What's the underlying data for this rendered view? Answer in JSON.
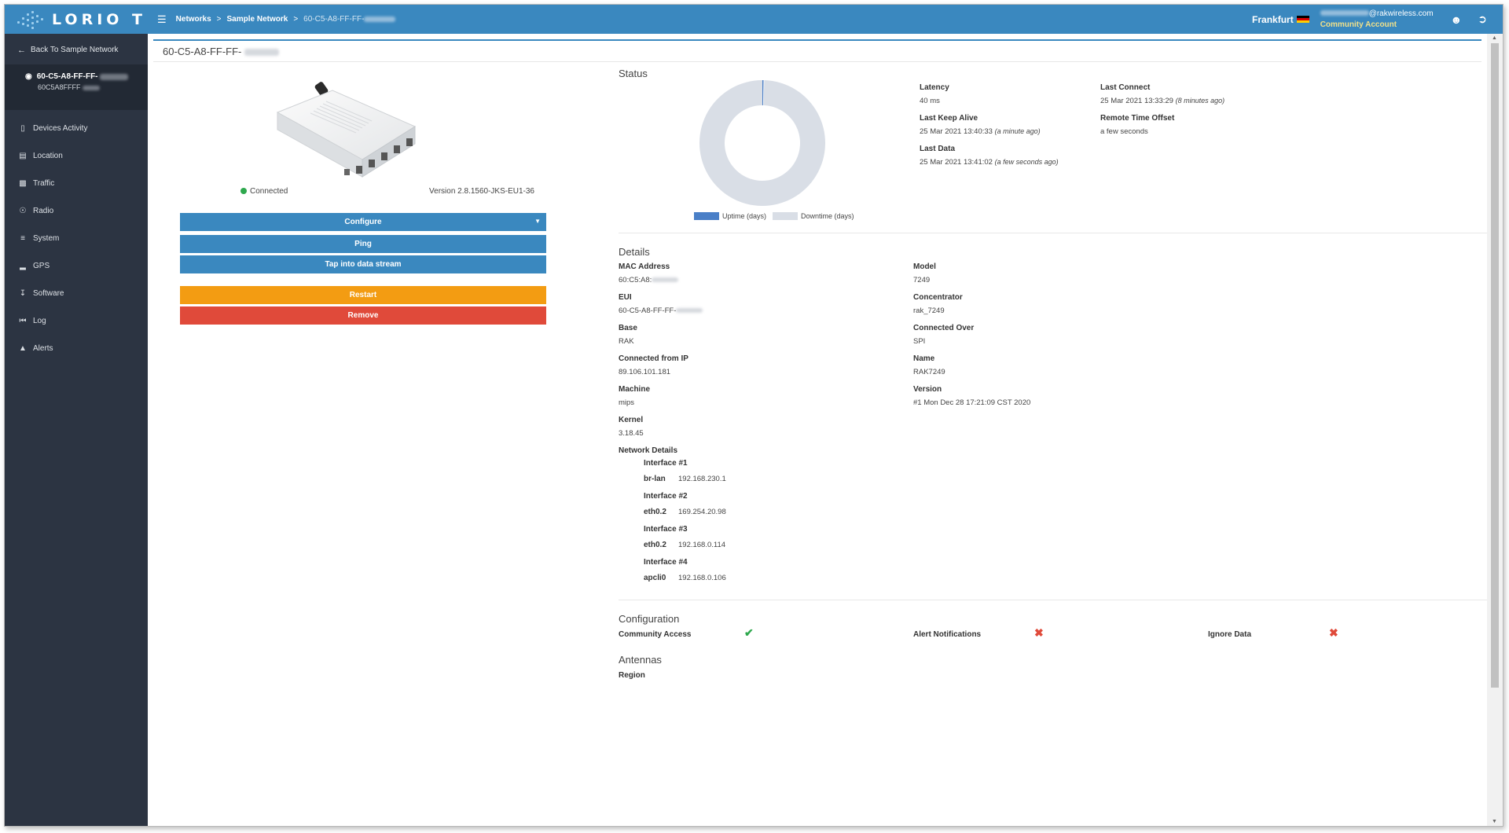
{
  "brand": {
    "logo_text": "LORIO T"
  },
  "sidebar": {
    "back_label": "Back To Sample Network",
    "device_name": "60-C5-A8-FF-FF-",
    "device_id": "60C5A8FFFF",
    "items": [
      {
        "label": "Devices Activity",
        "icon": "tablet-icon"
      },
      {
        "label": "Location",
        "icon": "map-icon"
      },
      {
        "label": "Traffic",
        "icon": "bar-chart-icon"
      },
      {
        "label": "Radio",
        "icon": "broadcast-icon"
      },
      {
        "label": "System",
        "icon": "sliders-icon"
      },
      {
        "label": "GPS",
        "icon": "signal-icon"
      },
      {
        "label": "Software",
        "icon": "download-icon"
      },
      {
        "label": "Log",
        "icon": "rewind-icon"
      },
      {
        "label": "Alerts",
        "icon": "warning-icon"
      }
    ]
  },
  "topbar": {
    "breadcrumb": [
      "Networks",
      "Sample Network",
      "60-C5-A8-FF-FF-"
    ],
    "region": "Frankfurt",
    "email": "@rakwireless.com",
    "account_type": "Community Account"
  },
  "device": {
    "title": "60-C5-A8-FF-FF-",
    "status": "Connected",
    "version": "Version 2.8.1560-JKS-EU1-36"
  },
  "buttons": {
    "configure": "Configure",
    "ping": "Ping",
    "tap": "Tap into data stream",
    "restart": "Restart",
    "remove": "Remove"
  },
  "status": {
    "title": "Status",
    "legend_uptime": "Uptime (days)",
    "legend_downtime": "Downtime (days)",
    "latency_label": "Latency",
    "latency_value": "40 ms",
    "last_keep_alive_label": "Last Keep Alive",
    "last_keep_alive_value": "25 Mar 2021 13:40:33",
    "last_keep_alive_ago": "(a minute ago)",
    "last_data_label": "Last Data",
    "last_data_value": "25 Mar 2021 13:41:02",
    "last_data_ago": "(a few seconds ago)",
    "last_connect_label": "Last Connect",
    "last_connect_value": "25 Mar 2021 13:33:29",
    "last_connect_ago": "(8 minutes ago)",
    "remote_offset_label": "Remote Time Offset",
    "remote_offset_value": "a few seconds",
    "uptime_fraction": 0.003,
    "colors": {
      "uptime": "#4a7fc7",
      "downtime": "#d9dee6"
    }
  },
  "details": {
    "title": "Details",
    "mac_label": "MAC Address",
    "mac_value": "60:C5:A8:",
    "model_label": "Model",
    "model_value": "7249",
    "eui_label": "EUI",
    "eui_value": "60-C5-A8-FF-FF-",
    "concentrator_label": "Concentrator",
    "concentrator_value": "rak_7249",
    "base_label": "Base",
    "base_value": "RAK",
    "connected_over_label": "Connected Over",
    "connected_over_value": "SPI",
    "ip_label": "Connected from IP",
    "ip_value": "89.106.101.181",
    "name_label": "Name",
    "name_value": "RAK7249",
    "machine_label": "Machine",
    "machine_value": "mips",
    "version_label": "Version",
    "version_value": "#1 Mon Dec 28 17:21:09 CST 2020",
    "kernel_label": "Kernel",
    "kernel_value": "3.18.45",
    "network_label": "Network Details",
    "interfaces": [
      {
        "title": "Interface #1",
        "name": "br-lan",
        "ip": "192.168.230.1"
      },
      {
        "title": "Interface #2",
        "name": "eth0.2",
        "ip": "169.254.20.98"
      },
      {
        "title": "Interface #3",
        "name": "eth0.2",
        "ip": "192.168.0.114"
      },
      {
        "title": "Interface #4",
        "name": "apcli0",
        "ip": "192.168.0.106"
      }
    ]
  },
  "configuration": {
    "title": "Configuration",
    "community_label": "Community Access",
    "alerts_label": "Alert Notifications",
    "ignore_label": "Ignore Data",
    "community_enabled": true,
    "alerts_enabled": false,
    "ignore_enabled": false
  },
  "antennas": {
    "title": "Antennas",
    "region_label": "Region"
  }
}
